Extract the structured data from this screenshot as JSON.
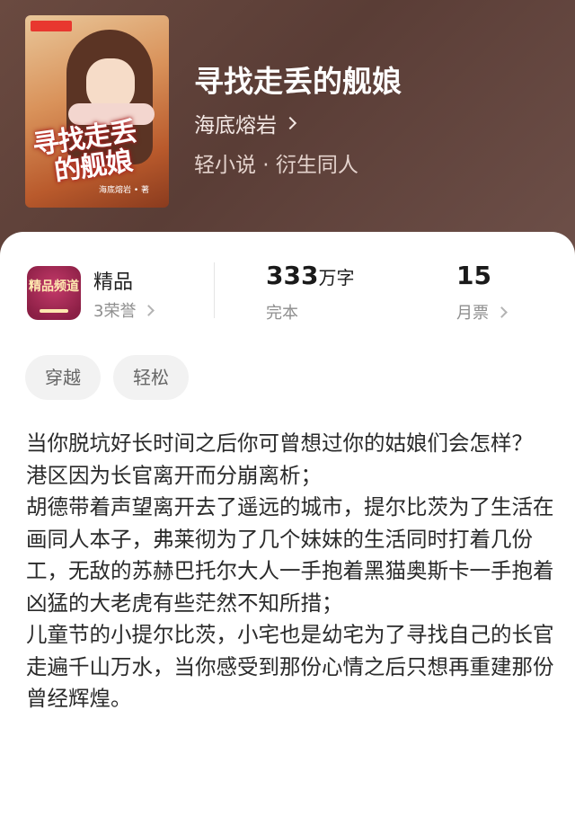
{
  "book": {
    "title": "寻找走丢的舰娘",
    "author": "海底熔岩",
    "genre": "轻小说 · 衍生同人",
    "cover": {
      "title_line1": "寻找走丢",
      "title_line2": "的舰娘",
      "author_small": "海底熔岩 • 著"
    }
  },
  "stats": {
    "channel": {
      "badge_text": "精品频道",
      "title": "精品",
      "honor": "3荣誉"
    },
    "words": {
      "value": "333",
      "unit": "万字",
      "status": "完本"
    },
    "tickets": {
      "value": "15",
      "label": "月票"
    }
  },
  "tags": [
    "穿越",
    "轻松"
  ],
  "description": [
    "当你脱坑好长时间之后你可曾想过你的姑娘们会怎样？",
    "港区因为长官离开而分崩离析；",
    "胡德带着声望离开去了遥远的城市，提尔比茨为了生活在画同人本子，弗莱彻为了几个妹妹的生活同时打着几份工，无敌的苏赫巴托尔大人一手抱着黑猫奥斯卡一手抱着凶猛的大老虎有些茫然不知所措；",
    "儿童节的小提尔比茨，小宅也是幼宅为了寻找自己的长官走遍千山万水，当你感受到那份心情之后只想再重建那份曾经辉煌。"
  ]
}
